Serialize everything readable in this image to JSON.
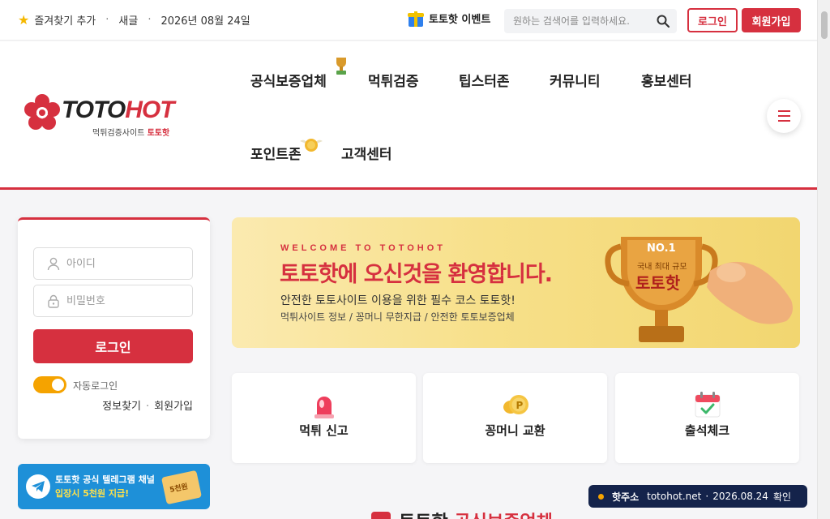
{
  "topbar": {
    "bookmark": "즐겨찾기 추가",
    "refresh": "새글",
    "date": "2026년 08월 24일",
    "event": "토토핫 이벤트",
    "search_placeholder": "원하는 검색어를 입력하세요.",
    "login": "로그인",
    "join": "회원가입"
  },
  "logo": {
    "brand_main": "TOTO",
    "brand_accent": "HOT",
    "tagline": "먹튀검증사이트",
    "tagline_brand": "토토핫"
  },
  "nav": {
    "items": [
      "공식보증업체",
      "먹튀검증",
      "팁스터존",
      "커뮤니티",
      "홍보센터",
      "포인트존",
      "고객센터"
    ]
  },
  "login_panel": {
    "id_placeholder": "아이디",
    "pw_placeholder": "비밀번호",
    "login_button": "로그인",
    "auto_login": "자동로그인",
    "auto_login_on": true,
    "find_info": "정보찾기",
    "join": "회원가입"
  },
  "telegram_banner": {
    "line1": "토토핫 공식 텔레그램 채널",
    "line2": "입장시 5천원 지급!",
    "ticket": "5천원"
  },
  "hero": {
    "welcome": "WELCOME TO TOTOHOT",
    "title": "토토핫에 오신것을 환영합니다.",
    "subtitle": "안전한 토토사이트 이용을 위한 필수 코스 토토핫!",
    "tags": "먹튀사이트 정보 / 꽁머니 무한지급 / 안전한 토토보증업체",
    "trophy_badge": "NO.1",
    "trophy_line1": "국내 최대 규모",
    "trophy_line2": "토토핫"
  },
  "quick_cards": [
    {
      "label": "먹튀 신고",
      "icon": "siren-icon"
    },
    {
      "label": "꽁머니 교환",
      "icon": "coin-icon"
    },
    {
      "label": "출석체크",
      "icon": "calendar-check-icon"
    }
  ],
  "bottom": {
    "heading_main": "토토핫",
    "heading_accent": "공식보증업체"
  },
  "notice": {
    "label": "핫주소",
    "domain": "totohot.net",
    "date": "2026.08.24",
    "confirm": "확인"
  },
  "colors": {
    "brand_red": "#d6303f",
    "accent_orange": "#f5a300",
    "navy": "#14234b",
    "telegram_blue": "#1e90d8"
  }
}
